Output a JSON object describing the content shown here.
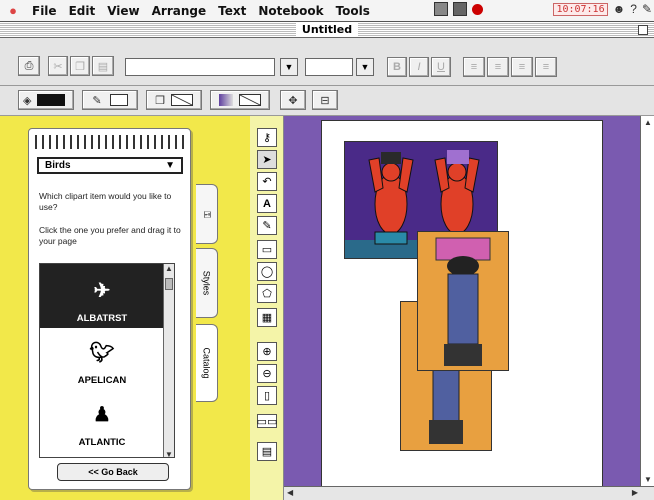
{
  "menubar": {
    "items": [
      "File",
      "Edit",
      "View",
      "Arrange",
      "Text",
      "Notebook",
      "Tools"
    ],
    "clock": "10:07:16"
  },
  "window": {
    "title": "Untitled"
  },
  "toolbar": {
    "style_buttons": [
      "B",
      "I",
      "U"
    ],
    "font_value": "",
    "size_value": ""
  },
  "catalog": {
    "category": "Birds",
    "prompt1": "Which clipart item would you like to use?",
    "prompt2": "Click the one you prefer and drag it to your page",
    "items": [
      "ALBATRST",
      "APELICAN",
      "ATLANTIC"
    ],
    "selected": "ALBATRST",
    "go_back": "<< Go Back"
  },
  "tabs": [
    "Styles",
    "Catalog"
  ],
  "colors": {
    "panel": "#f2e84a",
    "pasteboard": "#7a5ab0",
    "clip_dark": "#4a2a88",
    "clip_orange": "#e8a040",
    "figure_red": "#e04028"
  }
}
